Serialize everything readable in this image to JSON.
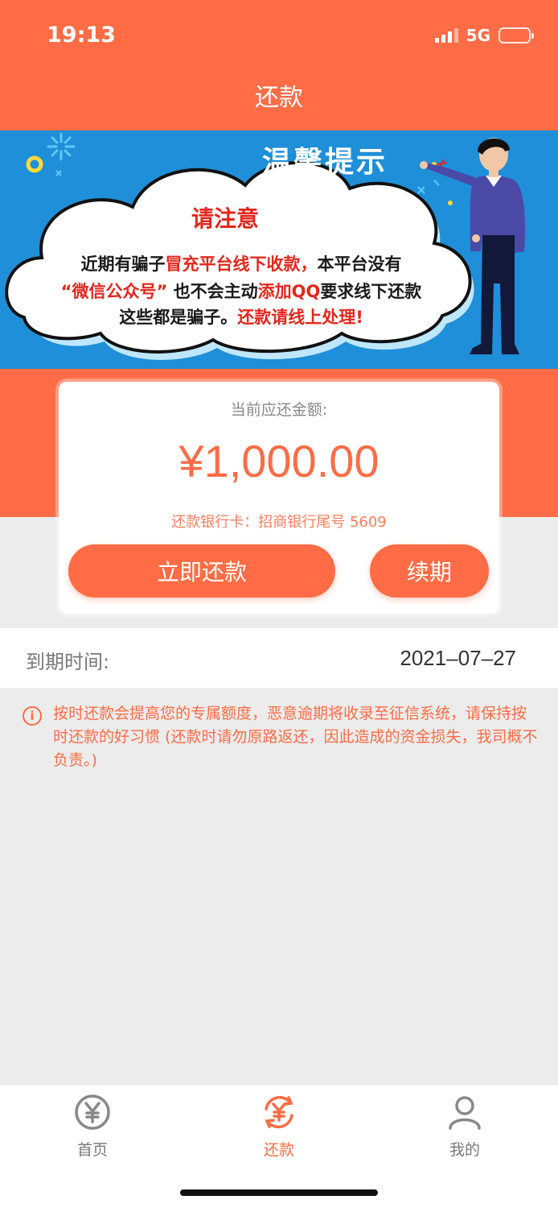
{
  "status_bar": {
    "time": "19:13",
    "network": "5G"
  },
  "header": {
    "title": "还款"
  },
  "banner": {
    "title": "温馨提示",
    "heading": "请注意",
    "line1": {
      "a": "近期有骗子",
      "b": "冒充平台线下收款，",
      "c": "本平台没有"
    },
    "line2": {
      "a": "“微信公众号”",
      "b": "也不会主动",
      "c": "添加QQ",
      "d": "要求线下还款"
    },
    "line3": {
      "a": "这些都是骗子。",
      "b": "还款请线上处理!"
    }
  },
  "card": {
    "label": "当前应还金额:",
    "amount": "¥1,000.00",
    "bank": "还款银行卡：招商银行尾号 5609",
    "pay_button": "立即还款",
    "renew_button": "续期"
  },
  "due": {
    "label": "到期时间:",
    "value": "2021–07–27"
  },
  "warning": {
    "icon": "i",
    "text": "按时还款会提高您的专属额度，恶意逾期将收录至征信系统，请保持按时还款的好习惯 (还款时请勿原路返还，因此造成的资金损失，我司概不负责。)"
  },
  "tabbar": {
    "items": [
      {
        "label": "首页",
        "icon": "yuan-circle-icon"
      },
      {
        "label": "还款",
        "icon": "yuan-refresh-icon"
      },
      {
        "label": "我的",
        "icon": "person-icon"
      }
    ],
    "active": "还款"
  },
  "colors": {
    "accent": "#ff6c45",
    "banner_blue": "#1e8fd8",
    "warning_red": "#e3271c"
  }
}
